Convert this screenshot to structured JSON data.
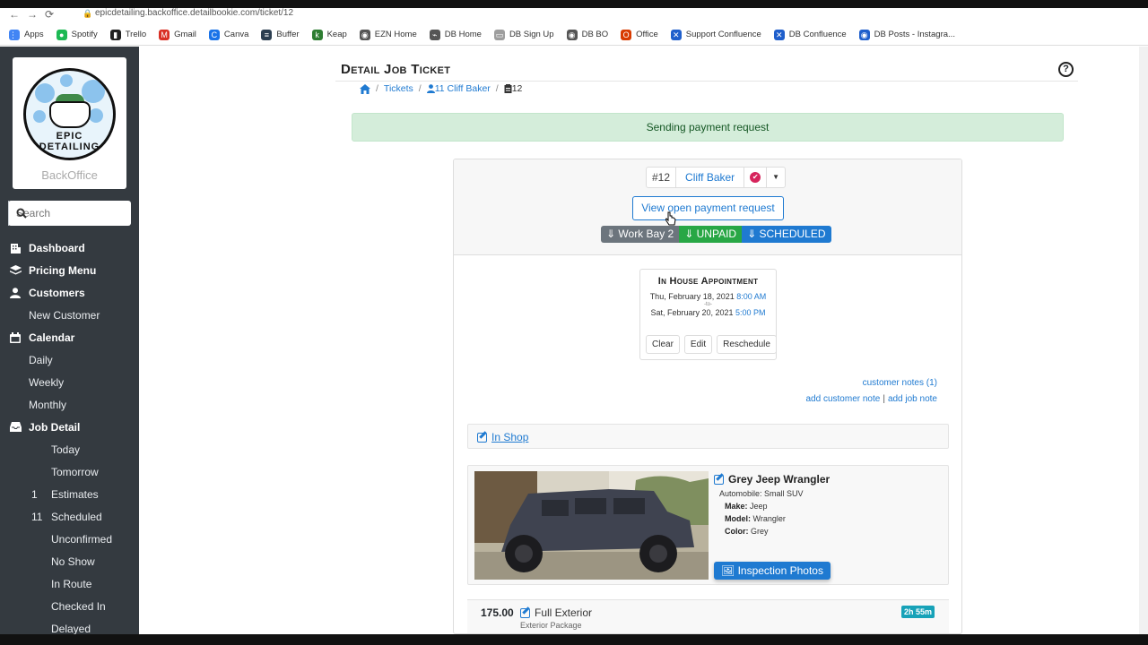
{
  "browser": {
    "url": "epicdetailing.backoffice.detailbookie.com/ticket/12",
    "bookmarks": [
      {
        "label": "Apps",
        "icon": "apps-grid-icon",
        "color": "#4285f4"
      },
      {
        "label": "Spotify",
        "icon": "spotify-icon",
        "color": "#1db954"
      },
      {
        "label": "Trello",
        "icon": "trello-icon",
        "color": "#222222"
      },
      {
        "label": "Gmail",
        "icon": "gmail-icon",
        "color": "#d93025"
      },
      {
        "label": "Canva",
        "icon": "canva-icon",
        "color": "#1a73e8"
      },
      {
        "label": "Buffer",
        "icon": "buffer-icon",
        "color": "#2c3e50"
      },
      {
        "label": "Keap",
        "icon": "keap-icon",
        "color": "#2e7d32"
      },
      {
        "label": "EZN Home",
        "icon": "globe-icon",
        "color": "#555555"
      },
      {
        "label": "DB Home",
        "icon": "db-icon",
        "color": "#555555"
      },
      {
        "label": "DB Sign Up",
        "icon": "page-icon",
        "color": "#9e9e9e"
      },
      {
        "label": "DB BO",
        "icon": "globe-icon",
        "color": "#555555"
      },
      {
        "label": "Office",
        "icon": "office-icon",
        "color": "#d83b01"
      },
      {
        "label": "Support Confluence",
        "icon": "confluence-icon",
        "color": "#1f5fcc"
      },
      {
        "label": "DB Confluence",
        "icon": "confluence-icon",
        "color": "#1f5fcc"
      },
      {
        "label": "DB Posts - Instagra...",
        "icon": "globe-icon",
        "color": "#1f5fcc"
      }
    ]
  },
  "sidebar": {
    "logo_text": "EPIC DETAILING",
    "subtitle": "BackOffice",
    "search_placeholder": "Search",
    "items": [
      {
        "label": "Dashboard",
        "level": "top",
        "icon": "building-icon"
      },
      {
        "label": "Pricing Menu",
        "level": "top",
        "icon": "layers-icon"
      },
      {
        "label": "Customers",
        "level": "top",
        "icon": "user-icon"
      },
      {
        "label": "New Customer",
        "level": "sub"
      },
      {
        "label": "Calendar",
        "level": "top",
        "icon": "calendar-icon"
      },
      {
        "label": "Daily",
        "level": "sub"
      },
      {
        "label": "Weekly",
        "level": "sub"
      },
      {
        "label": "Monthly",
        "level": "sub"
      },
      {
        "label": "Job Detail",
        "level": "top",
        "icon": "inbox-icon"
      },
      {
        "label": "Today",
        "level": "sub2",
        "count": ""
      },
      {
        "label": "Tomorrow",
        "level": "sub2",
        "count": ""
      },
      {
        "label": "Estimates",
        "level": "sub2",
        "count": "1"
      },
      {
        "label": "Scheduled",
        "level": "sub2",
        "count": "11"
      },
      {
        "label": "Unconfirmed",
        "level": "sub2",
        "count": ""
      },
      {
        "label": "No Show",
        "level": "sub2",
        "count": ""
      },
      {
        "label": "In Route",
        "level": "sub2",
        "count": ""
      },
      {
        "label": "Checked In",
        "level": "sub2",
        "count": ""
      },
      {
        "label": "Delayed",
        "level": "sub2",
        "count": ""
      }
    ]
  },
  "header": {
    "title": "Detail Job Ticket",
    "help": "?"
  },
  "breadcrumb": {
    "tickets": "Tickets",
    "customer": "11 Cliff Baker",
    "current": "12"
  },
  "alert": {
    "message": "Sending payment request"
  },
  "ticket": {
    "number": "#12",
    "customer": "Cliff Baker",
    "view_payment_label": "View open payment request",
    "status": {
      "bay": "Work Bay 2",
      "payment": "UNPAID",
      "state": "SCHEDULED"
    },
    "appointment": {
      "title": "In House Appointment",
      "start_date": "Thu, February 18, 2021",
      "start_time": "8:00 AM",
      "to": "-to-",
      "end_date": "Sat, February 20, 2021",
      "end_time": "5:00 PM",
      "clear": "Clear",
      "edit": "Edit",
      "reschedule": "Reschedule"
    },
    "notes": {
      "customer_notes": "customer notes (1)",
      "add_customer_note": "add customer note",
      "add_job_note": "add job note"
    },
    "location": "In Shop",
    "vehicle": {
      "name": "Grey Jeep Wrangler",
      "type": "Automobile: Small SUV",
      "make_label": "Make:",
      "make": "Jeep",
      "model_label": "Model:",
      "model": "Wrangler",
      "color_label": "Color:",
      "color": "Grey",
      "inspection_label": "Inspection Photos"
    },
    "service": {
      "price": "175.00",
      "name": "Full Exterior",
      "package": "Exterior Package",
      "duration": "2h 55m"
    }
  },
  "colors": {
    "primary": "#1f7ad1",
    "success": "#28a745",
    "secondary": "#6c757d",
    "info": "#17a2b8",
    "danger": "#d6245c",
    "sidebar": "#343a40"
  }
}
